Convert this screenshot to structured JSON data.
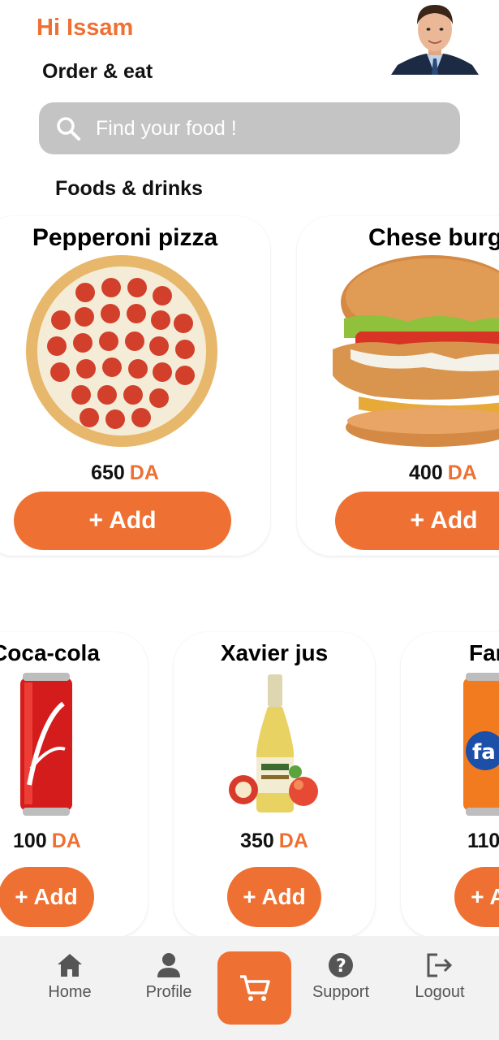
{
  "header": {
    "greeting": "Hi Issam",
    "subtitle": "Order & eat",
    "avatar_icon": "user-avatar"
  },
  "search": {
    "placeholder": "Find your food !",
    "icon": "search-icon"
  },
  "section": {
    "title": "Foods & drinks"
  },
  "currency": "DA",
  "add_label": "+ Add",
  "foods": [
    {
      "name": "Pepperoni pizza",
      "price": "650",
      "icon": "pizza-icon"
    },
    {
      "name": "Chese burger",
      "price": "400",
      "icon": "burger-icon"
    }
  ],
  "drinks": [
    {
      "name": "Coca-cola",
      "price": "100",
      "icon": "cola-can-icon"
    },
    {
      "name": "Xavier jus",
      "price": "350",
      "icon": "juice-bottle-icon"
    },
    {
      "name": "Fanta",
      "price": "110",
      "icon": "fanta-can-icon"
    }
  ],
  "nav": {
    "items": [
      {
        "label": "Home",
        "icon": "home-icon"
      },
      {
        "label": "Profile",
        "icon": "profile-icon"
      },
      {
        "label": "",
        "icon": "cart-icon"
      },
      {
        "label": "Support",
        "icon": "help-icon"
      },
      {
        "label": "Logout",
        "icon": "logout-icon"
      }
    ]
  },
  "colors": {
    "accent": "#ee7032",
    "search_bg": "#c4c4c4",
    "nav_bg": "#f2f2f2"
  }
}
